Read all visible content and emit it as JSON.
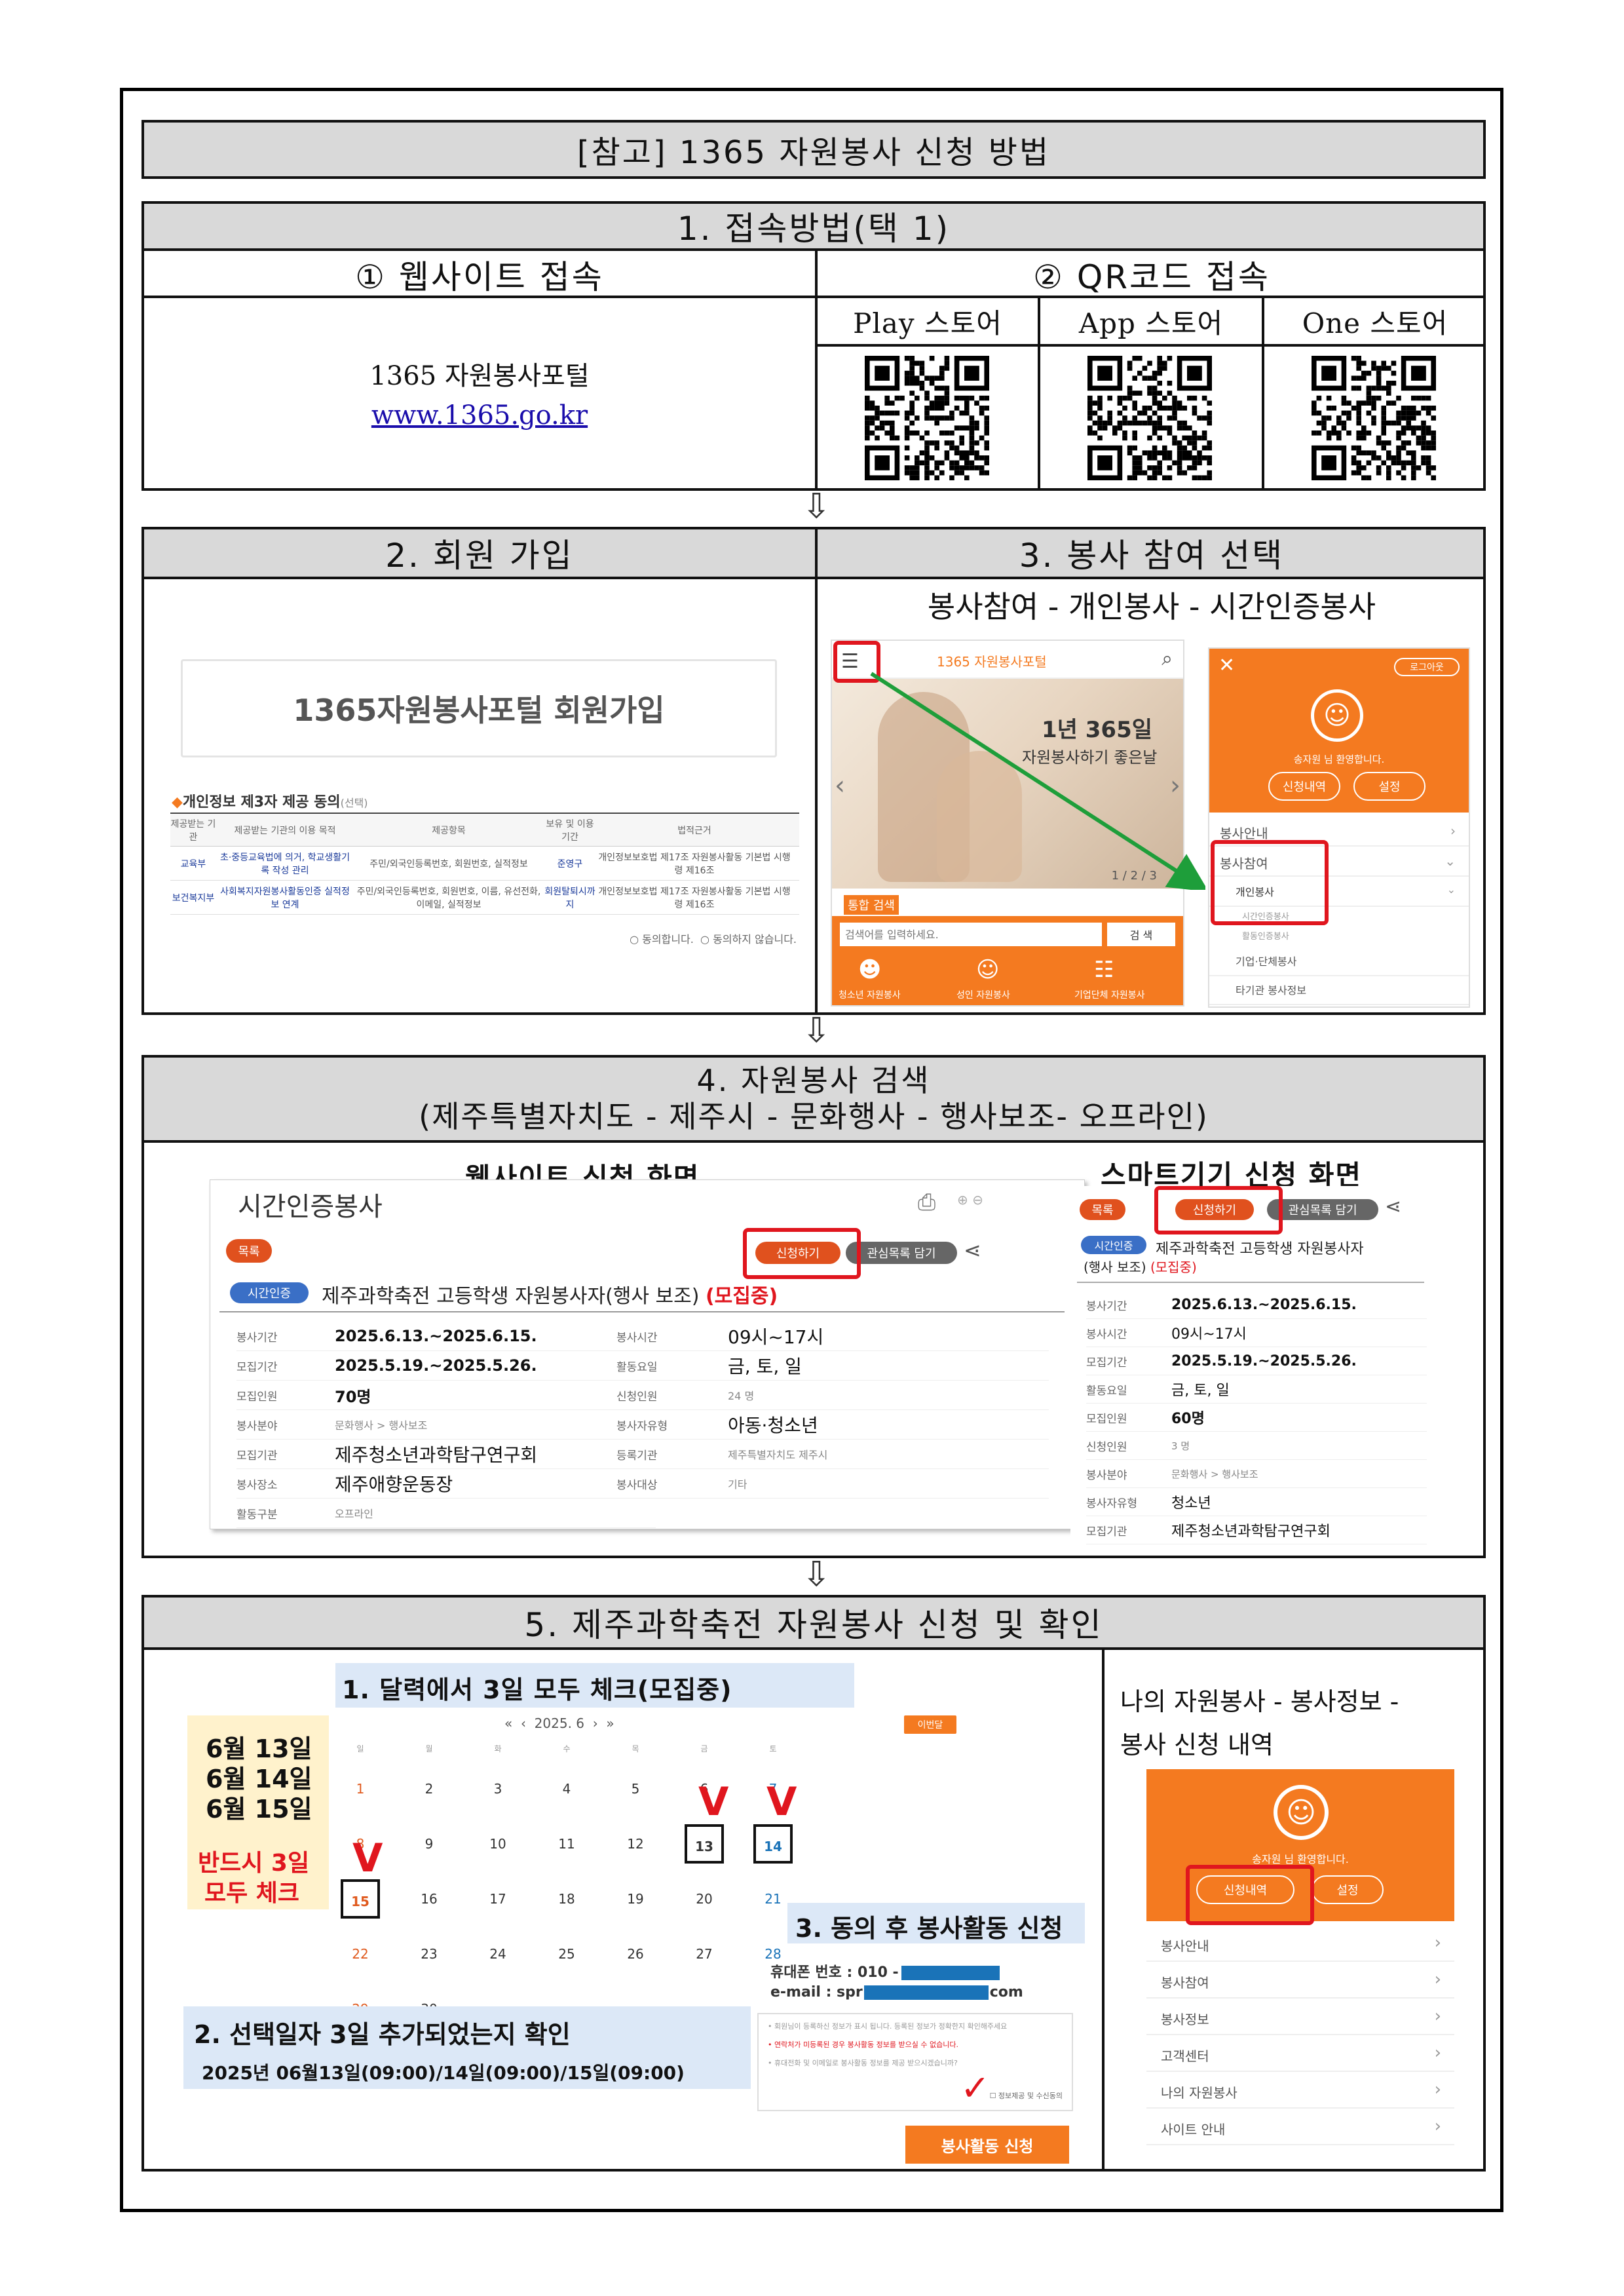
{
  "title": "[참고] 1365 자원봉사 신청 방법",
  "section1": {
    "title": "1. 접속방법(택 1)",
    "web": {
      "heading": "① 웹사이트 접속",
      "portal": "1365 자원봉사포털",
      "url": "www.1365.go.kr"
    },
    "qr": {
      "heading": "② QR코드 접속",
      "stores": [
        "Play 스토어",
        "App 스토어",
        "One 스토어"
      ]
    }
  },
  "arrow": "⇩",
  "section2": {
    "title": "2. 회원 가입",
    "shot": {
      "banner": "1365자원봉사포털 회원가입",
      "consent_title": "개인정보 제3자 제공 동의",
      "consent_optional": "(선택)",
      "columns": [
        "제공받는 기관",
        "제공받는 기관의 이용 목적",
        "제공항목",
        "보유 및 이용기간",
        "법적근거"
      ],
      "rows": [
        [
          "교육부",
          "초·중등교육법에 의거, 학교생활기록 작성 관리",
          "주민/외국인등록번호, 회원번호, 실적정보",
          "준영구",
          "개인정보보호법 제17조 자원봉사활동 기본법 시행령 제16조"
        ],
        [
          "보건복지부",
          "사회복지자원봉사활동인증 실적정보 연계",
          "주민/외국인등록번호, 회원번호, 이름, 유선전화, 이메일, 실적정보",
          "회원탈퇴시까지",
          "개인정보보호법 제17조 자원봉사활동 기본법 시행령 제16조"
        ]
      ],
      "agree": "○ 동의합니다.",
      "disagree": "○ 동의하지 않습니다."
    }
  },
  "section3": {
    "title": "3. 봉사 참여 선택",
    "path": "봉사참여 - 개인봉사 - 시간인증봉사",
    "phone1": {
      "logo": "1365 자원봉사포털",
      "slogan1": "1년 365일",
      "slogan2": "자원봉사하기 좋은날",
      "pager": "1 / 2 / 3",
      "search_label": "통합 검색",
      "search_placeholder": "검색어를 입력하세요.",
      "search_button": "검 색",
      "icons": [
        "청소년 자원봉사",
        "성인 자원봉사",
        "기업단체 자원봉사"
      ]
    },
    "phone2": {
      "logout": "로그아웃",
      "welcome": "송자원 님 환영합니다.",
      "btn1": "신청내역",
      "btn2": "설정",
      "menu": [
        "봉사안내",
        "봉사참여",
        "개인봉사",
        "시간인증봉사",
        "활동인증봉사",
        "기업·단체봉사",
        "타기관 봉사정보"
      ]
    }
  },
  "section4": {
    "title": "4. 자원봉사 검색",
    "subtitle": "(제주특별자치도 - 제주시 - 문화행사 - 행사보조- 오프라인)",
    "web": {
      "heading": "웹사이트 신청 화면",
      "page_title": "시간인증봉사",
      "list_btn": "목록",
      "apply_btn": "신청하기",
      "fav_btn": "관심목록 담기",
      "badge": "시간인증",
      "event": "제주과학축전 고등학생 자원봉사자(행사 보조)",
      "status": "(모집중)",
      "left": [
        [
          "봉사기간",
          "2025.6.13.~2025.6.15."
        ],
        [
          "모집기간",
          "2025.5.19.~2025.5.26."
        ],
        [
          "모집인원",
          "70명"
        ],
        [
          "봉사분야",
          "문화행사 > 행사보조"
        ],
        [
          "모집기관",
          "제주청소년과학탐구연구회"
        ],
        [
          "봉사장소",
          "제주애향운동장"
        ],
        [
          "활동구분",
          "오프라인"
        ]
      ],
      "right": [
        [
          "봉사시간",
          "09시~17시"
        ],
        [
          "활동요일",
          "금, 토, 일"
        ],
        [
          "신청인원",
          "24 명"
        ],
        [
          "봉사자유형",
          "아동·청소년"
        ],
        [
          "등록기관",
          "제주특별자치도 제주시"
        ],
        [
          "봉사대상",
          "기타"
        ]
      ]
    },
    "mobile": {
      "heading": "스마트기기 신청 화면",
      "list_btn": "목록",
      "apply_btn": "신청하기",
      "fav_btn": "관심목록 담기",
      "badge": "시간인증",
      "event1": "제주과학축전 고등학생 자원봉사자",
      "event2": "(행사 보조)",
      "status": "(모집중)",
      "rows": [
        [
          "봉사기간",
          "2025.6.13.~2025.6.15."
        ],
        [
          "봉사시간",
          "09시~17시"
        ],
        [
          "모집기간",
          "2025.5.19.~2025.5.26."
        ],
        [
          "활동요일",
          "금, 토, 일"
        ],
        [
          "모집인원",
          "60명"
        ],
        [
          "신청인원",
          "3 명"
        ],
        [
          "봉사분야",
          "문화행사 > 행사보조"
        ],
        [
          "봉사자유형",
          "청소년"
        ],
        [
          "모집기관",
          "제주청소년과학탐구연구회"
        ]
      ]
    }
  },
  "section5": {
    "title": "5. 제주과학축전 자원봉사 신청 및 확인",
    "step1": "1. 달력에서 3일 모두 체크(모집중)",
    "dates": [
      "6월 13일",
      "6월 14일",
      "6월 15일"
    ],
    "must1": "반드시 3일",
    "must2": "모두 체크",
    "calendar": {
      "nav": "«  ‹  2025. 6  ›  »",
      "today_btn": "이번달",
      "weekdays": [
        "일",
        "월",
        "화",
        "수",
        "목",
        "금",
        "토"
      ],
      "weeks": [
        [
          "1",
          "2",
          "3",
          "4",
          "5",
          "6",
          "7"
        ],
        [
          "8",
          "9",
          "10",
          "11",
          "12",
          "13",
          "14"
        ],
        [
          "15",
          "16",
          "17",
          "18",
          "19",
          "20",
          "21"
        ],
        [
          "22",
          "23",
          "24",
          "25",
          "26",
          "27",
          "28"
        ],
        [
          "29",
          "30",
          "",
          "",
          "",
          "",
          ""
        ]
      ]
    },
    "step2": "2. 선택일자 3일 추가되었는지 확인",
    "step2_value": "2025년 06월13일(09:00)/14일(09:00)/15일(09:00)",
    "step3": "3. 동의 후 봉사활동 신청",
    "phone_label": "휴대폰 번호 : 010 -",
    "email_label": "e-mail : spr",
    "email_suffix": "com",
    "notes": [
      "• 회원님이 등록하신 정보가 표시 됩니다. 등록된 정보가 정확한지 확인해주세요",
      "• 연락처가 미등록된 경우 봉사활동 정보를 받으실 수 없습니다.",
      "• 휴대전화 및 이메일로 봉사활동 정보를 제공 받으시겠습니까?"
    ],
    "agree_label": "정보제공 및 수신동의",
    "apply_btn": "봉사활동 신청",
    "right_text1": "나의 자원봉사 - 봉사정보 -",
    "right_text2": "봉사 신청 내역",
    "right_phone": {
      "welcome": "송자원 님 환영합니다.",
      "btn1": "신청내역",
      "btn2": "설정",
      "menu": [
        "봉사안내",
        "봉사참여",
        "봉사정보",
        "고객센터",
        "나의 자원봉사",
        "사이트 안내"
      ]
    }
  },
  "colors": {
    "header_gray": "#d9d9d9",
    "orange": "#f47a20",
    "red": "#e0161e",
    "link": "#1a0dab",
    "highlight": "#fff2cc",
    "note_blue": "#dce8f7"
  }
}
